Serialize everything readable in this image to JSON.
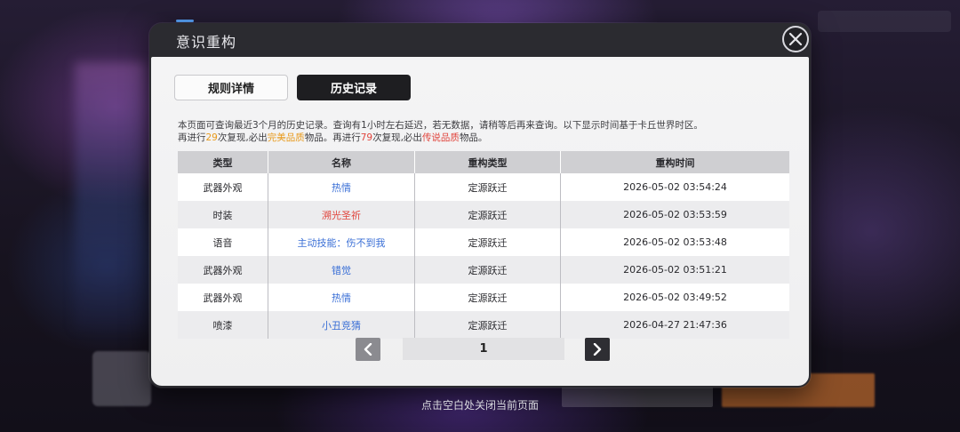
{
  "dialog": {
    "title": "意识重构",
    "close_icon": "close-icon"
  },
  "tabs": [
    {
      "label": "规则详情",
      "active": false
    },
    {
      "label": "历史记录",
      "active": true
    }
  ],
  "description": {
    "line1": "本页面可查询最近3个月的历史记录。查询有1小时左右延迟，若无数据，请稍等后再来查询。以下显示时间基于卡丘世界时区。",
    "line2_pre": "再进行",
    "count_perfect": "29",
    "line2_mid1": "次复现,必出",
    "quality_perfect": "完美品质",
    "line2_mid2": "物品。再进行",
    "count_legend": "79",
    "line2_mid3": "次复现,必出",
    "quality_legend": "传说品质",
    "line2_post": "物品。"
  },
  "table": {
    "headers": [
      "类型",
      "名称",
      "重构类型",
      "重构时间"
    ],
    "rows": [
      {
        "type": "武器外观",
        "name": "热情",
        "name_color": "blue",
        "method": "定源跃迁",
        "time": "2026-05-02  03:54:24"
      },
      {
        "type": "时装",
        "name": "溯光圣祈",
        "name_color": "red",
        "method": "定源跃迁",
        "time": "2026-05-02  03:53:59"
      },
      {
        "type": "语音",
        "name": "主动技能：伤不到我",
        "name_color": "blue",
        "method": "定源跃迁",
        "time": "2026-05-02  03:53:48"
      },
      {
        "type": "武器外观",
        "name": "错觉",
        "name_color": "blue",
        "method": "定源跃迁",
        "time": "2026-05-02  03:51:21"
      },
      {
        "type": "武器外观",
        "name": "热情",
        "name_color": "blue",
        "method": "定源跃迁",
        "time": "2026-05-02  03:49:52"
      },
      {
        "type": "喷漆",
        "name": "小丑竞猜",
        "name_color": "blue",
        "method": "定源跃迁",
        "time": "2026-04-27  21:47:36"
      }
    ]
  },
  "pager": {
    "page": "1",
    "prev_icon": "chevron-left-icon",
    "next_icon": "chevron-right-icon"
  },
  "footer": {
    "hint": "点击空白处关闭当前页面"
  },
  "colors": {
    "blue_name": "#3a6fd6",
    "red_name": "#e0443c",
    "orange_highlight": "#e89a1c"
  }
}
